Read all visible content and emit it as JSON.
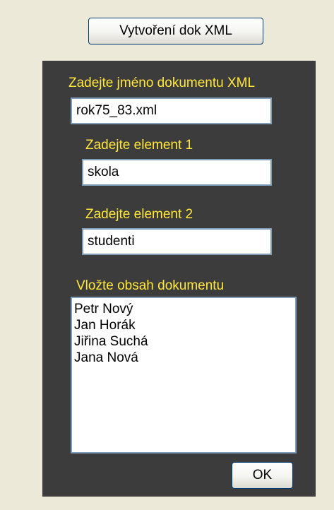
{
  "top_button": {
    "label": "Vytvoření dok XML"
  },
  "labels": {
    "document_name": "Zadejte jméno dokumentu XML",
    "element1": "Zadejte element 1",
    "element2": "Zadejte element 2",
    "content": "Vložte obsah dokumentu"
  },
  "fields": {
    "document_name": "rok75_83.xml",
    "element1": "skola",
    "element2": "studenti"
  },
  "content_lines": [
    "Petr Nový",
    "Jan Horák",
    "Jiřina Suchá",
    "Jana Nová"
  ],
  "ok_button": {
    "label": "OK"
  }
}
